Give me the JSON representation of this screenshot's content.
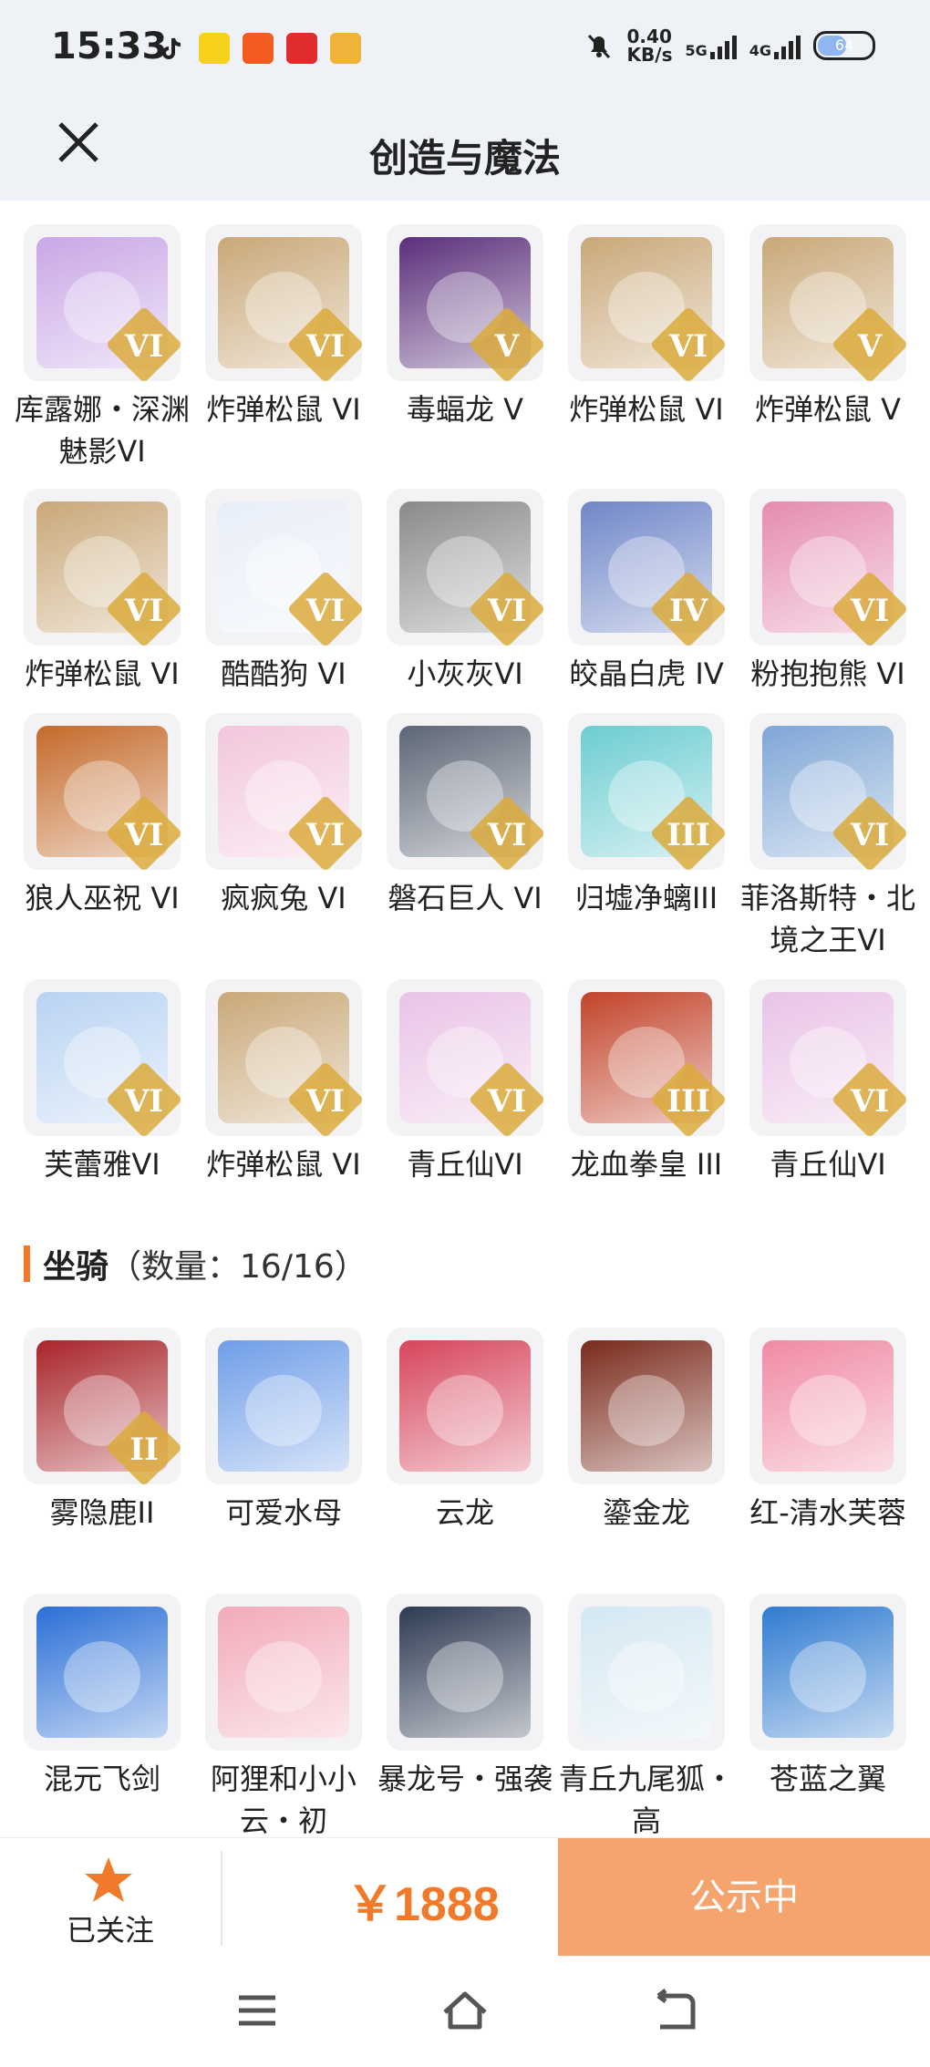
{
  "status_bar": {
    "time": "15:33",
    "net_speed_value": "0.40",
    "net_speed_unit": "KB/s",
    "signal_1": "5G",
    "signal_2": "4G",
    "battery": "64"
  },
  "header": {
    "title": "创造与魔法",
    "close_icon": "close-icon"
  },
  "pets": [
    {
      "label": "库露娜・深渊魅影VI",
      "tier": "VI",
      "art_color": "#c9a7e6"
    },
    {
      "label": "炸弹松鼠 VI",
      "tier": "VI",
      "art_color": "#c9a878"
    },
    {
      "label": "毒蝠龙 V",
      "tier": "V",
      "art_color": "#5a2f7a"
    },
    {
      "label": "炸弹松鼠 VI",
      "tier": "VI",
      "art_color": "#c9a878"
    },
    {
      "label": "炸弹松鼠 V",
      "tier": "V",
      "art_color": "#c9a878"
    },
    {
      "label": "炸弹松鼠 VI",
      "tier": "VI",
      "art_color": "#c9a878"
    },
    {
      "label": "酷酷狗 VI",
      "tier": "VI",
      "art_color": "#e8eef8"
    },
    {
      "label": "小灰灰VI",
      "tier": "VI",
      "art_color": "#8a8a8a"
    },
    {
      "label": "皎晶白虎 IV",
      "tier": "IV",
      "art_color": "#6f86c8"
    },
    {
      "label": "粉抱抱熊 VI",
      "tier": "VI",
      "art_color": "#e58bb0"
    },
    {
      "label": "狼人巫祝 VI",
      "tier": "VI",
      "art_color": "#c46a2a"
    },
    {
      "label": "疯疯兔 VI",
      "tier": "VI",
      "art_color": "#f2c6dc"
    },
    {
      "label": "磐石巨人 VI",
      "tier": "VI",
      "art_color": "#5d6676"
    },
    {
      "label": "归墟净螭III",
      "tier": "III",
      "art_color": "#6ccdd1"
    },
    {
      "label": "菲洛斯特・北境之王VI",
      "tier": "VI",
      "art_color": "#7fa6d6"
    },
    {
      "label": "芙蕾雅VI",
      "tier": "VI",
      "art_color": "#b9d3f2"
    },
    {
      "label": "炸弹松鼠 VI",
      "tier": "VI",
      "art_color": "#c9a878"
    },
    {
      "label": "青丘仙VI",
      "tier": "VI",
      "art_color": "#e9c3e6"
    },
    {
      "label": "龙血拳皇 III",
      "tier": "III",
      "art_color": "#c2432a"
    },
    {
      "label": "青丘仙VI",
      "tier": "VI",
      "art_color": "#e9c3e6"
    }
  ],
  "mounts_section": {
    "title": "坐骑",
    "count": "（数量：16/16）"
  },
  "mounts": [
    {
      "label": "雾隐鹿II",
      "tier": "II",
      "art_color": "#a8242a"
    },
    {
      "label": "可爱水母",
      "tier": "",
      "art_color": "#6f9ee8"
    },
    {
      "label": "云龙",
      "tier": "",
      "art_color": "#d6455c"
    },
    {
      "label": "鎏金龙",
      "tier": "",
      "art_color": "#7a2a1c"
    },
    {
      "label": "红-清水芙蓉",
      "tier": "",
      "art_color": "#f08aa4"
    },
    {
      "label": "混元飞剑",
      "tier": "",
      "art_color": "#2a6fd6"
    },
    {
      "label": "阿狸和小小云・初",
      "tier": "",
      "art_color": "#f2aab9"
    },
    {
      "label": "暴龙号・强袭",
      "tier": "",
      "art_color": "#2d3a52"
    },
    {
      "label": "青丘九尾狐・高",
      "tier": "",
      "art_color": "#d4e8f2"
    },
    {
      "label": "苍蓝之翼",
      "tier": "",
      "art_color": "#2f7bd0"
    }
  ],
  "bottom_bar": {
    "follow_label": "已关注",
    "price": "￥1888",
    "status_label": "公示中"
  },
  "colors": {
    "accent": "#f07a2a",
    "status_button": "#f6a46e",
    "header_bg": "#eef2f7"
  }
}
